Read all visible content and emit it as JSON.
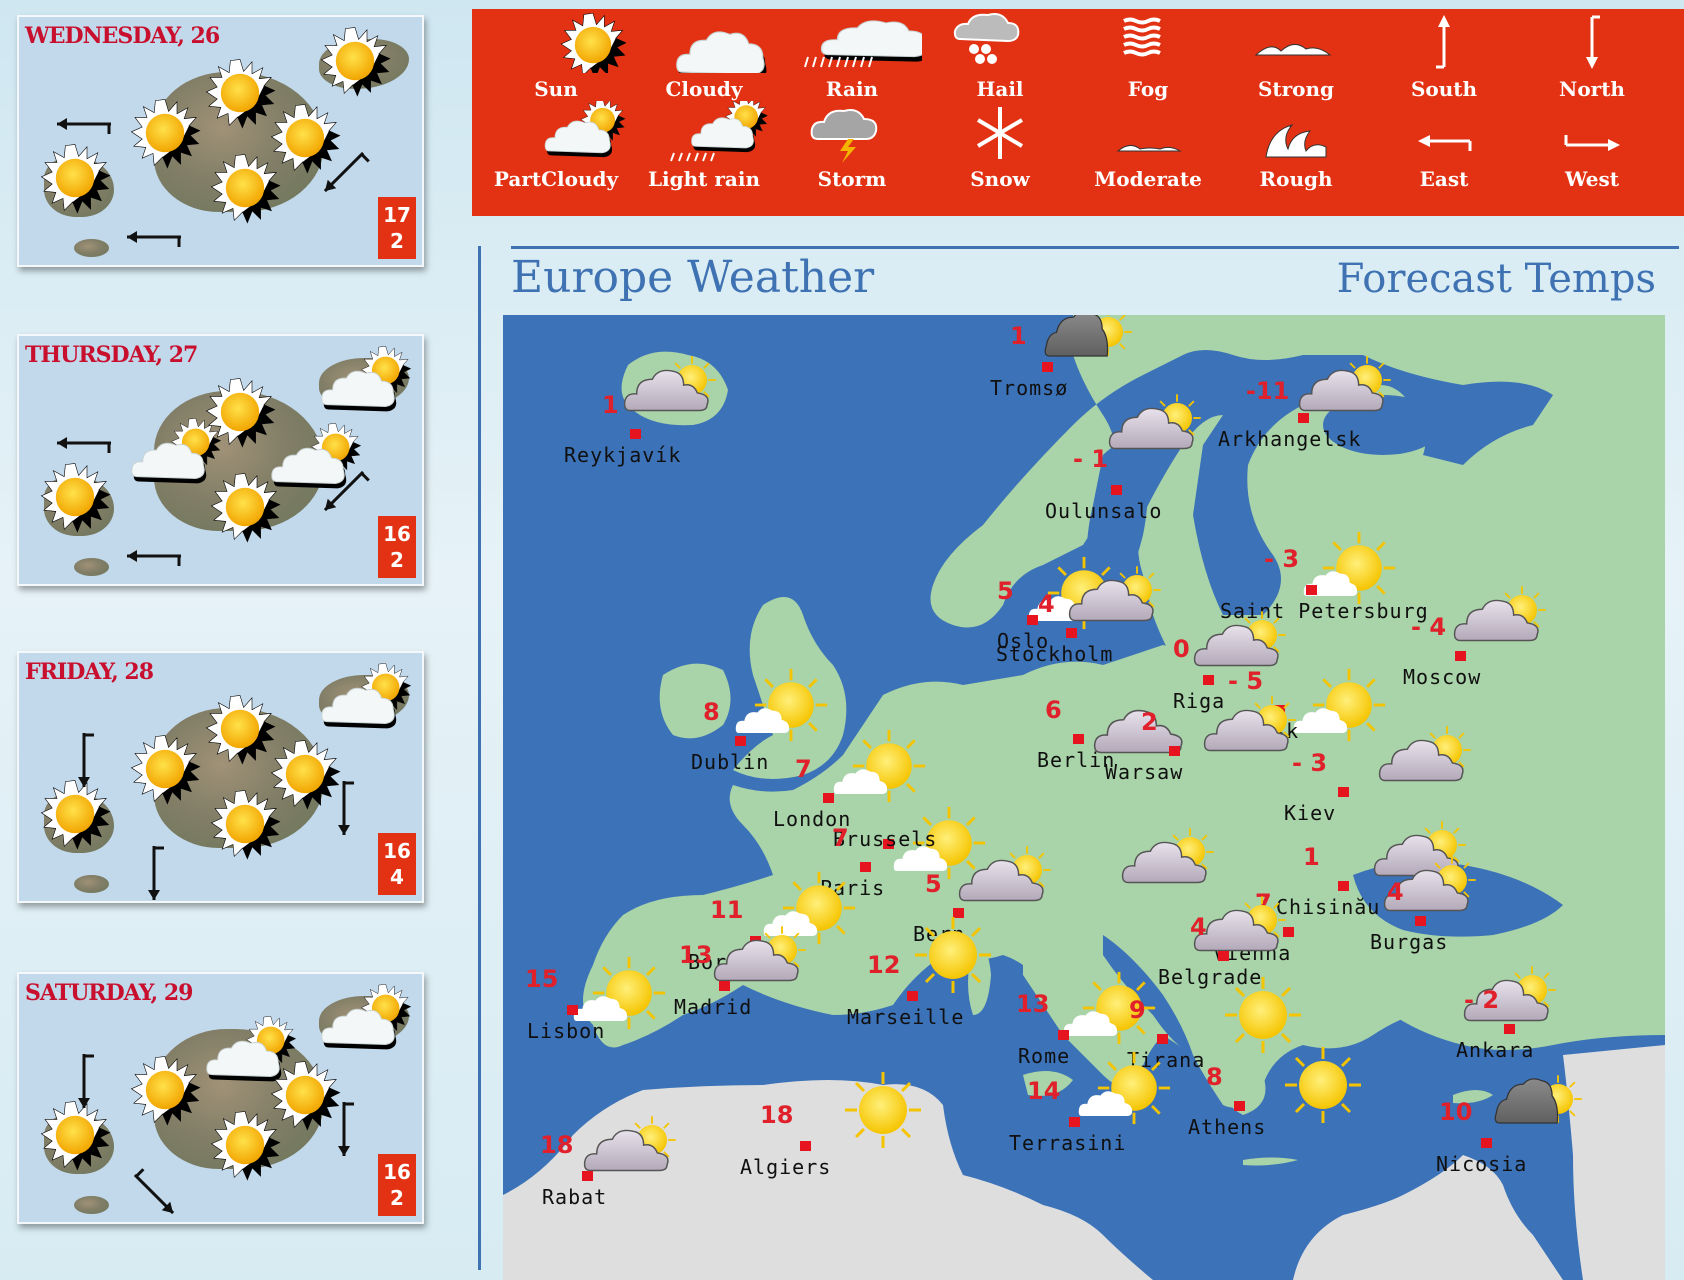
{
  "forecast_cards": [
    {
      "title": "WEDNESDAY, 26",
      "max_temp": "17",
      "min_temp": "2",
      "icons": [
        "sun",
        "sun",
        "sun",
        "sun",
        "sun",
        "sun"
      ],
      "wind": [
        "east",
        "east",
        "north-east"
      ]
    },
    {
      "title": "THURSDAY, 27",
      "max_temp": "16",
      "min_temp": "2",
      "icons": [
        "sun",
        "part-cloudy",
        "sun",
        "part-cloudy",
        "sun",
        "part-cloudy"
      ],
      "wind": [
        "east",
        "east",
        "north-east"
      ]
    },
    {
      "title": "FRIDAY, 28",
      "max_temp": "16",
      "min_temp": "4",
      "icons": [
        "sun",
        "sun",
        "sun",
        "sun",
        "sun",
        "part-cloudy"
      ],
      "wind": [
        "north",
        "north",
        "north"
      ]
    },
    {
      "title": "SATURDAY, 29",
      "max_temp": "16",
      "min_temp": "2",
      "icons": [
        "sun",
        "sun",
        "part-cloudy",
        "sun",
        "sun",
        "light-rain"
      ],
      "wind": [
        "north",
        "north-west",
        "north"
      ]
    }
  ],
  "legend": {
    "items": [
      {
        "label": "Sun",
        "icon": "sun"
      },
      {
        "label": "Cloudy",
        "icon": "cloudy"
      },
      {
        "label": "Rain",
        "icon": "rain"
      },
      {
        "label": "Hail",
        "icon": "hail"
      },
      {
        "label": "Fog",
        "icon": "fog"
      },
      {
        "label": "Strong",
        "icon": "sea-strong"
      },
      {
        "label": "South",
        "icon": "wind-south"
      },
      {
        "label": "North",
        "icon": "wind-north"
      },
      {
        "label": "PartCloudy",
        "icon": "part-cloudy"
      },
      {
        "label": "Light rain",
        "icon": "light-rain"
      },
      {
        "label": "Storm",
        "icon": "storm"
      },
      {
        "label": "Snow",
        "icon": "snow"
      },
      {
        "label": "Moderate",
        "icon": "sea-moderate"
      },
      {
        "label": "Rough",
        "icon": "sea-rough"
      },
      {
        "label": "East",
        "icon": "wind-east"
      },
      {
        "label": "West",
        "icon": "wind-west"
      }
    ]
  },
  "header": {
    "title": "Europe Weather",
    "subtitle": "Forecast Temps"
  },
  "colors": {
    "accent_red": "#e23213",
    "title_blue": "#3f72b2",
    "sea": "#3c72b8",
    "land": "#a9d3a8",
    "africa": "#dedede",
    "temp_red": "#e0202a"
  },
  "map": {
    "cities": [
      {
        "name": "Reykjavík",
        "temp": "1",
        "icon": "cloudy-sun"
      },
      {
        "name": "Tromsø",
        "temp": "1",
        "icon": "dark-cloud-sun"
      },
      {
        "name": "Arkhangelsk",
        "temp": "-11",
        "icon": "cloudy-sun"
      },
      {
        "name": "Oulunsalo",
        "temp": "- 1",
        "icon": "cloudy-sun"
      },
      {
        "name": "Saint Petersburg",
        "temp": "- 3",
        "icon": "sun-cloud"
      },
      {
        "name": "Oslo",
        "temp": "5",
        "icon": "sun-cloud"
      },
      {
        "name": "Stockholm",
        "temp": "4",
        "icon": "cloudy-sun"
      },
      {
        "name": "Riga",
        "temp": "0",
        "icon": "cloudy-sun"
      },
      {
        "name": "Moscow",
        "temp": "- 4",
        "icon": "cloudy-sun"
      },
      {
        "name": "Dublin",
        "temp": "8",
        "icon": "sun-cloud"
      },
      {
        "name": "London",
        "temp": "7",
        "icon": "sun-cloud"
      },
      {
        "name": "Brussels",
        "temp": "",
        "icon": "sun-cloud"
      },
      {
        "name": "Minsk",
        "temp": "- 5",
        "icon": "sun-cloud"
      },
      {
        "name": "Berlin",
        "temp": "6",
        "icon": "cloudy"
      },
      {
        "name": "Warsaw",
        "temp": "2",
        "icon": "cloudy-sun"
      },
      {
        "name": "Kiev",
        "temp": "- 3",
        "icon": "cloudy-sun"
      },
      {
        "name": "Paris",
        "temp": "7",
        "icon": ""
      },
      {
        "name": "Bern",
        "temp": "5",
        "icon": "cloudy-sun"
      },
      {
        "name": "Vienna",
        "temp": "7",
        "icon": "cloudy-sun"
      },
      {
        "name": "Chisinău",
        "temp": "1",
        "icon": "cloudy-sun"
      },
      {
        "name": "Bordeaux",
        "temp": "11",
        "icon": "sun-cloud"
      },
      {
        "name": "Belgrade",
        "temp": "4",
        "icon": "cloudy-sun"
      },
      {
        "name": "Burgas",
        "temp": "4",
        "icon": "cloudy-sun"
      },
      {
        "name": "Marseille",
        "temp": "12",
        "icon": "sun"
      },
      {
        "name": "Madrid",
        "temp": "13",
        "icon": "cloudy-sun"
      },
      {
        "name": "Lisbon",
        "temp": "15",
        "icon": "sun-cloud"
      },
      {
        "name": "Rome",
        "temp": "13",
        "icon": "sun-cloud"
      },
      {
        "name": "Tirana",
        "temp": "9",
        "icon": "sun"
      },
      {
        "name": "Ankara",
        "temp": "- 2",
        "icon": "cloudy-sun"
      },
      {
        "name": "Terrasini",
        "temp": "14",
        "icon": "sun-cloud"
      },
      {
        "name": "Athens",
        "temp": "8",
        "icon": "sun"
      },
      {
        "name": "Nicosia",
        "temp": "10",
        "icon": "dark-cloud-sun"
      },
      {
        "name": "Algiers",
        "temp": "18",
        "icon": "sun"
      },
      {
        "name": "Rabat",
        "temp": "18",
        "icon": "cloudy-sun"
      }
    ]
  }
}
